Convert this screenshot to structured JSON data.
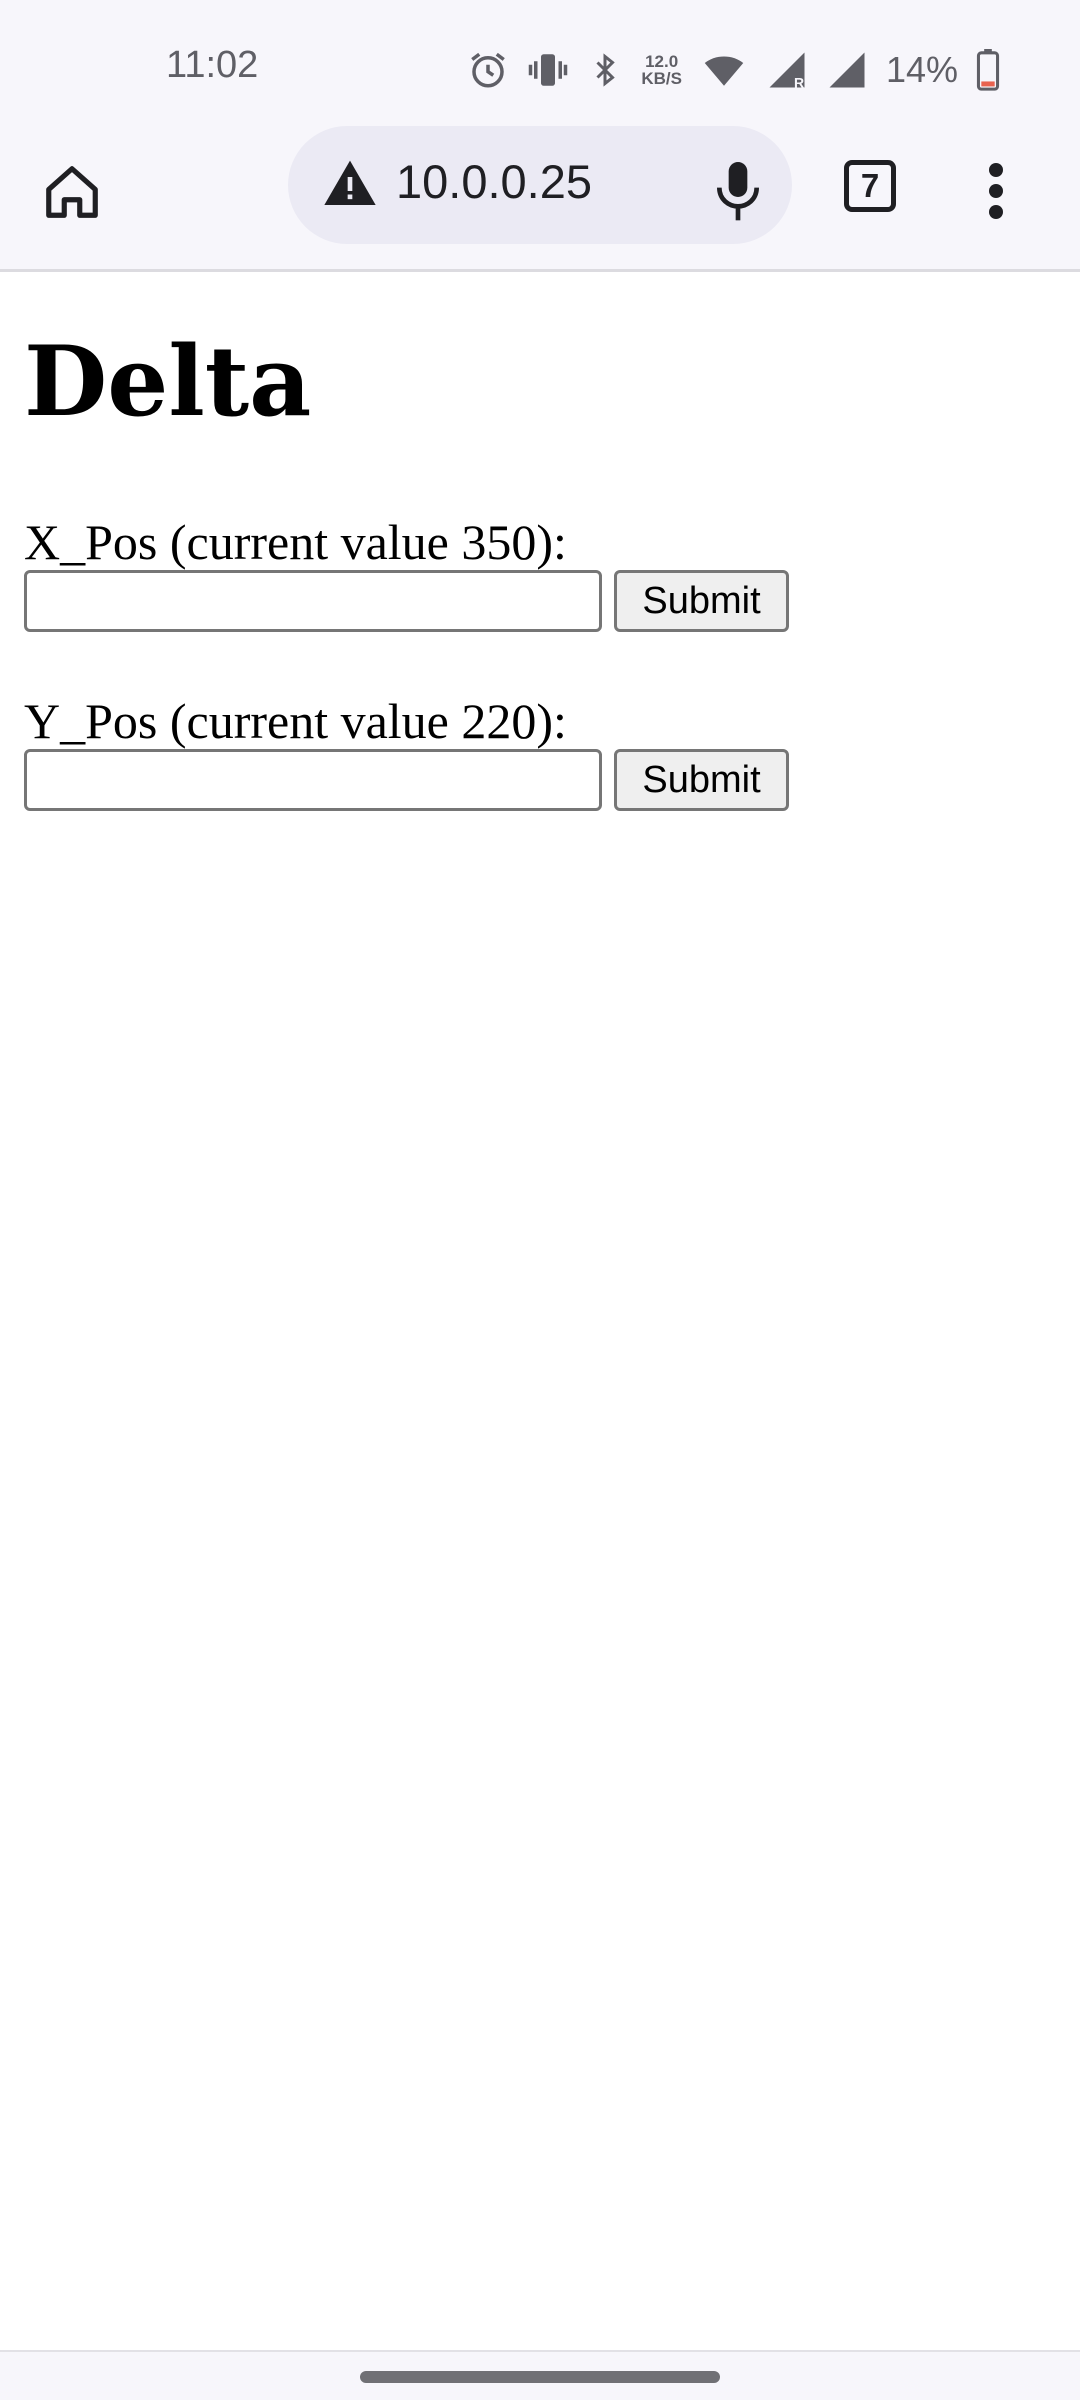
{
  "status_bar": {
    "time": "11:02",
    "net_speed_value": "12.0",
    "net_speed_unit": "KB/S",
    "battery_percent": "14%",
    "icons": [
      "alarm-icon",
      "vibrate-icon",
      "bluetooth-icon",
      "wifi-icon",
      "signal-roaming-icon",
      "signal-icon",
      "battery-icon"
    ]
  },
  "browser": {
    "url": "10.0.0.25",
    "tab_count": "7",
    "icons": [
      "home-icon",
      "warning-icon",
      "mic-icon",
      "tabs-icon",
      "more-vert-icon"
    ]
  },
  "page": {
    "title": "Delta",
    "fields": [
      {
        "label": "X_Pos (current value 350):",
        "value": "",
        "button": "Submit"
      },
      {
        "label": "Y_Pos (current value 220):",
        "value": "",
        "button": "Submit"
      }
    ]
  },
  "colors": {
    "chrome_bg": "#f7f6fb",
    "url_bar_bg": "#ebeaf4",
    "status_text": "#5f5f66",
    "button_bg": "#efefef",
    "input_border": "#767676",
    "battery_low": "#e8624f"
  }
}
